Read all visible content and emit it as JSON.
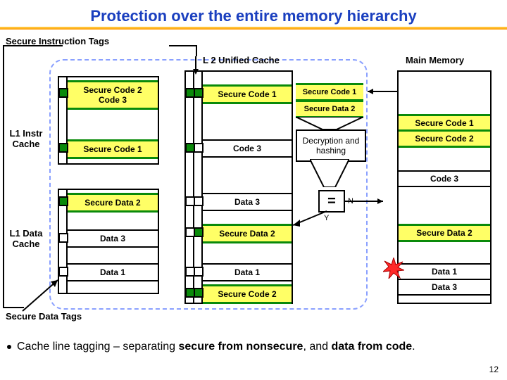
{
  "title": "Protection over the entire memory hierarchy",
  "labels": {
    "sit": "Secure Instruction Tags",
    "sdt": "Secure Data Tags",
    "l1i": "L1 Instr Cache",
    "l1d": "L1 Data Cache",
    "l2": "L 2 Unified Cache",
    "mm": "Main Memory",
    "dec": "Decryption and hashing",
    "eq": "=",
    "Y": "Y",
    "N": "N"
  },
  "l1i": {
    "r0a": "Secure Code 2",
    "r0b": "Code 3",
    "r1": "Secure Code 1"
  },
  "l1d_rows": {
    "r0": "Secure Data 2",
    "r1": "Data 3",
    "r2": "Data 1"
  },
  "l2": {
    "c0": "Secure Code 1",
    "c1": "Code 3",
    "c2": "Data 3",
    "c3": "Secure Data 2",
    "c4": "Data 1",
    "c5": "Secure Code 2"
  },
  "onchip_labels": {
    "sc1": "Secure Code 1",
    "sd2": "Secure Data 2"
  },
  "mm": {
    "m0": "Secure Code 1",
    "m1": "Secure Code 2",
    "m2": "Code 3",
    "m3": "Secure Data 2",
    "m4": "Data 1",
    "m5": "Data 3"
  },
  "bullet": {
    "pre": "Cache line tagging – separating ",
    "b1": "secure from nonsecure",
    "mid": ", and ",
    "b2": "data from code",
    "post": "."
  },
  "slide": "12"
}
